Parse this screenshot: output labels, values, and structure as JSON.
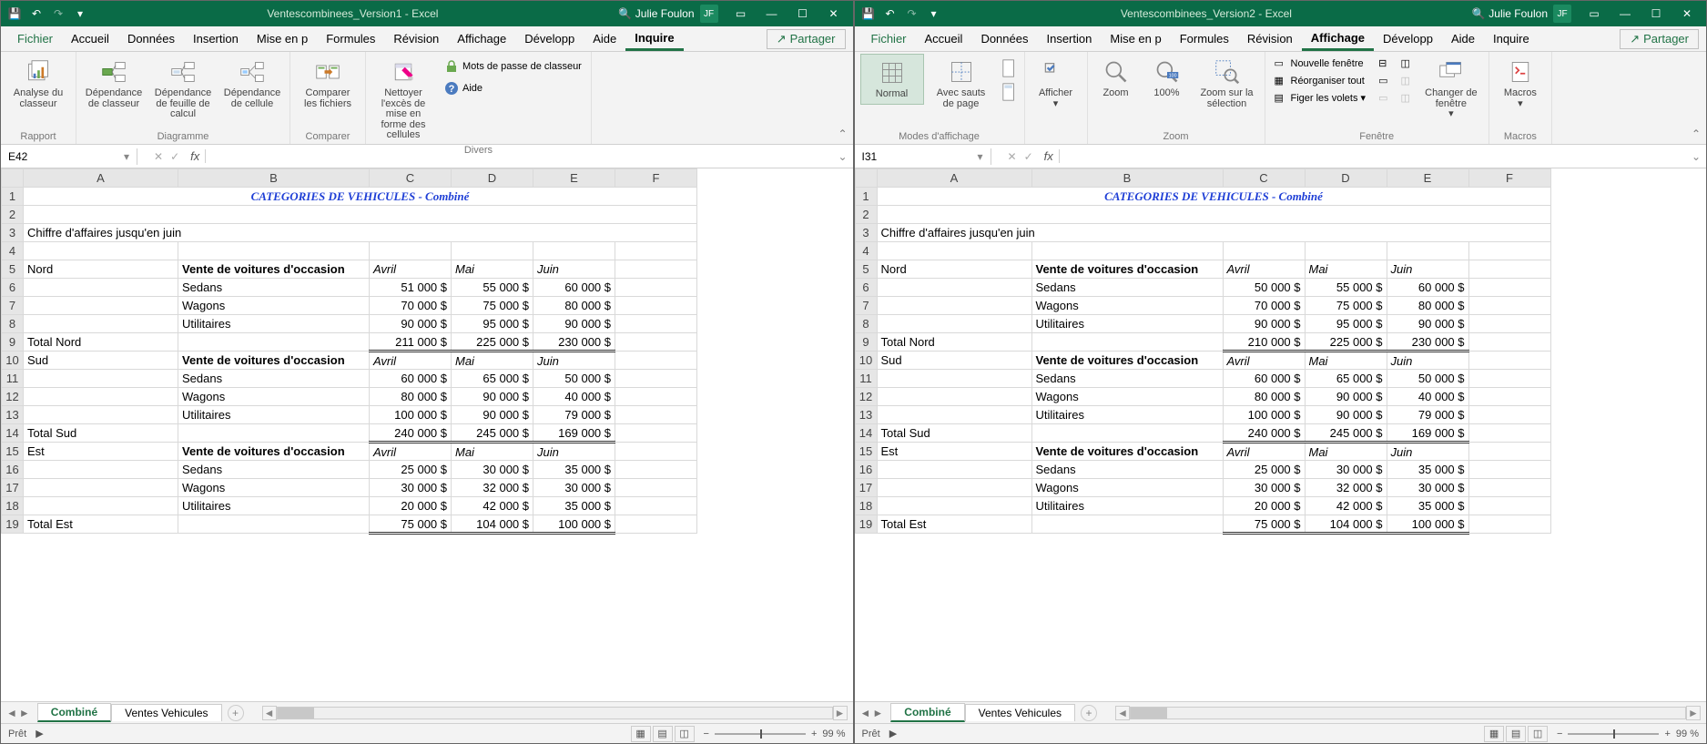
{
  "windows": [
    {
      "filename": "Ventescombinees_Version1",
      "app": "Excel",
      "user": "Julie Foulon",
      "avatar": "JF",
      "namebox": "E42",
      "tabs": [
        "Fichier",
        "Accueil",
        "Données",
        "Insertion",
        "Mise en p",
        "Formules",
        "Révision",
        "Affichage",
        "Développ",
        "Aide",
        "Inquire"
      ],
      "active_tab": "Inquire",
      "share": "Partager",
      "ribbon": {
        "groups": [
          {
            "name": "Rapport",
            "items": [
              {
                "label": "Analyse du classeur",
                "icon": "workbook"
              }
            ]
          },
          {
            "name": "Diagramme",
            "items": [
              {
                "label": "Dépendance de classeur",
                "icon": "dep1"
              },
              {
                "label": "Dépendance de feuille de calcul",
                "icon": "dep2"
              },
              {
                "label": "Dépendance de cellule",
                "icon": "dep3"
              }
            ]
          },
          {
            "name": "Comparer",
            "items": [
              {
                "label": "Comparer les fichiers",
                "icon": "compare"
              }
            ]
          },
          {
            "name": "Divers",
            "items": [
              {
                "label": "Nettoyer l'excès de mise en forme des cellules",
                "icon": "clean"
              }
            ],
            "side_items": [
              {
                "label": "Mots de passe de classeur",
                "icon": "lock"
              },
              {
                "label": "Aide",
                "icon": "help"
              }
            ]
          }
        ]
      },
      "sheet_title": "CATEGORIES DE VEHICULES - Combiné",
      "subtitle": "Chiffre d'affaires jusqu'en juin",
      "sections": [
        {
          "region": "Nord",
          "hdr": "Vente de voitures d'occasion",
          "months": [
            "Avril",
            "Mai",
            "Juin"
          ],
          "rows": [
            [
              "Sedans",
              "51 000 $",
              "55 000 $",
              "60 000 $"
            ],
            [
              "Wagons",
              "70 000 $",
              "75 000 $",
              "80 000 $"
            ],
            [
              "Utilitaires",
              "90 000 $",
              "95 000 $",
              "90 000 $"
            ]
          ],
          "total_label": "Total Nord",
          "totals": [
            "211 000 $",
            "225 000 $",
            "230 000 $"
          ]
        },
        {
          "region": "Sud",
          "hdr": "Vente de voitures d'occasion",
          "months": [
            "Avril",
            "Mai",
            "Juin"
          ],
          "rows": [
            [
              "Sedans",
              "60 000 $",
              "65 000 $",
              "50 000 $"
            ],
            [
              "Wagons",
              "80 000 $",
              "90 000 $",
              "40 000 $"
            ],
            [
              "Utilitaires",
              "100 000 $",
              "90 000 $",
              "79 000 $"
            ]
          ],
          "total_label": "Total Sud",
          "totals": [
            "240 000 $",
            "245 000 $",
            "169 000 $"
          ]
        },
        {
          "region": "Est",
          "hdr": "Vente de voitures d'occasion",
          "months": [
            "Avril",
            "Mai",
            "Juin"
          ],
          "rows": [
            [
              "Sedans",
              "25 000 $",
              "30 000 $",
              "35 000 $"
            ],
            [
              "Wagons",
              "30 000 $",
              "32 000 $",
              "30 000 $"
            ],
            [
              "Utilitaires",
              "20 000 $",
              "42 000 $",
              "35 000 $"
            ]
          ],
          "total_label": "Total Est",
          "totals": [
            "75 000 $",
            "104 000 $",
            "100 000 $"
          ]
        }
      ],
      "sheets": {
        "active": "Combiné",
        "other": "Ventes Vehicules"
      },
      "status": "Prêt",
      "zoom": "99 %"
    },
    {
      "filename": "Ventescombinees_Version2",
      "app": "Excel",
      "user": "Julie Foulon",
      "avatar": "JF",
      "namebox": "I31",
      "tabs": [
        "Fichier",
        "Accueil",
        "Données",
        "Insertion",
        "Mise en p",
        "Formules",
        "Révision",
        "Affichage",
        "Développ",
        "Aide",
        "Inquire"
      ],
      "active_tab": "Affichage",
      "share": "Partager",
      "ribbon_af": {
        "group1": "Modes d'affichage",
        "normal": "Normal",
        "sauts": "Avec sauts de page",
        "afficher": "Afficher",
        "group2": "Zoom",
        "zoom": "Zoom",
        "z100": "100%",
        "zsel": "Zoom sur la sélection",
        "group3": "Fenêtre",
        "nouv": "Nouvelle fenêtre",
        "reorg": "Réorganiser tout",
        "figer": "Figer les volets",
        "chang": "Changer de fenêtre",
        "group4": "Macros",
        "macros": "Macros"
      },
      "sheet_title": "CATEGORIES DE VEHICULES - Combiné",
      "subtitle": "Chiffre d'affaires jusqu'en juin",
      "sections": [
        {
          "region": "Nord",
          "hdr": "Vente de voitures d'occasion",
          "months": [
            "Avril",
            "Mai",
            "Juin"
          ],
          "rows": [
            [
              "Sedans",
              "50 000 $",
              "55 000 $",
              "60 000 $"
            ],
            [
              "Wagons",
              "70 000 $",
              "75 000 $",
              "80 000 $"
            ],
            [
              "Utilitaires",
              "90 000 $",
              "95 000 $",
              "90 000 $"
            ]
          ],
          "total_label": "Total Nord",
          "totals": [
            "210 000 $",
            "225 000 $",
            "230 000 $"
          ]
        },
        {
          "region": "Sud",
          "hdr": "Vente de voitures d'occasion",
          "months": [
            "Avril",
            "Mai",
            "Juin"
          ],
          "rows": [
            [
              "Sedans",
              "60 000 $",
              "65 000 $",
              "50 000 $"
            ],
            [
              "Wagons",
              "80 000 $",
              "90 000 $",
              "40 000 $"
            ],
            [
              "Utilitaires",
              "100 000 $",
              "90 000 $",
              "79 000 $"
            ]
          ],
          "total_label": "Total Sud",
          "totals": [
            "240 000 $",
            "245 000 $",
            "169 000 $"
          ]
        },
        {
          "region": "Est",
          "hdr": "Vente de voitures d'occasion",
          "months": [
            "Avril",
            "Mai",
            "Juin"
          ],
          "rows": [
            [
              "Sedans",
              "25 000 $",
              "30 000 $",
              "35 000 $"
            ],
            [
              "Wagons",
              "30 000 $",
              "32 000 $",
              "30 000 $"
            ],
            [
              "Utilitaires",
              "20 000 $",
              "42 000 $",
              "35 000 $"
            ]
          ],
          "total_label": "Total Est",
          "totals": [
            "75 000 $",
            "104 000 $",
            "100 000 $"
          ]
        }
      ],
      "sheets": {
        "active": "Combiné",
        "other": "Ventes Vehicules"
      },
      "status": "Prêt",
      "zoom": "99 %"
    }
  ],
  "columns": [
    "A",
    "B",
    "C",
    "D",
    "E",
    "F"
  ]
}
